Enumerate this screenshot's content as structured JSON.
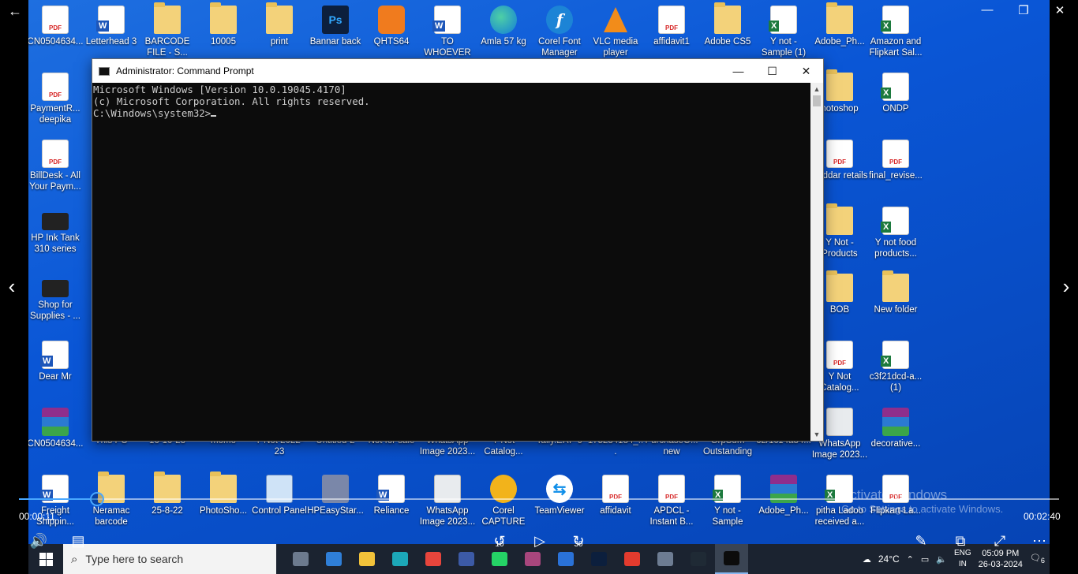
{
  "desktop": {
    "icons": [
      {
        "label": "CN0504634...",
        "kind": "pdf",
        "glyph": ""
      },
      {
        "label": "Letterhead 3",
        "kind": "word",
        "glyph": ""
      },
      {
        "label": "BARCODE FILE - S...",
        "kind": "folder",
        "glyph": ""
      },
      {
        "label": "10005",
        "kind": "folder",
        "glyph": ""
      },
      {
        "label": "print",
        "kind": "folder",
        "glyph": ""
      },
      {
        "label": "Bannar back",
        "kind": "ps",
        "glyph": "Ps"
      },
      {
        "label": "QHTS64",
        "kind": "orange",
        "glyph": ""
      },
      {
        "label": "TO WHOEVER ...",
        "kind": "word",
        "glyph": ""
      },
      {
        "label": "Amla 57 kg",
        "kind": "edge",
        "glyph": ""
      },
      {
        "label": "Corel Font Manager",
        "kind": "corel",
        "glyph": "f"
      },
      {
        "label": "VLC media player",
        "kind": "vlc",
        "glyph": ""
      },
      {
        "label": "affidavit1",
        "kind": "pdf",
        "glyph": ""
      },
      {
        "label": "Adobe CS5",
        "kind": "folder",
        "glyph": ""
      },
      {
        "label": "Y not - Sample (1)",
        "kind": "excel",
        "glyph": ""
      },
      {
        "label": "Adobe_Ph...",
        "kind": "folder",
        "glyph": ""
      },
      {
        "label": "Amazon and Flipkart Sal...",
        "kind": "excel",
        "glyph": ""
      },
      {
        "label": "PaymentR... deepika",
        "kind": "pdf",
        "glyph": ""
      },
      {
        "label": "hotoshop",
        "kind": "folder",
        "glyph": ""
      },
      {
        "label": "ONDP",
        "kind": "excel",
        "glyph": ""
      },
      {
        "label": "BillDesk - All Your Paym...",
        "kind": "pdf",
        "glyph": ""
      },
      {
        "label": "Poddar retails",
        "kind": "pdf",
        "glyph": ""
      },
      {
        "label": "final_revise...",
        "kind": "pdf",
        "glyph": ""
      },
      {
        "label": "HP Ink Tank 310 series",
        "kind": "printer",
        "glyph": ""
      },
      {
        "label": "Y Not - Products",
        "kind": "folder",
        "glyph": ""
      },
      {
        "label": "Y not food products...",
        "kind": "excel",
        "glyph": ""
      },
      {
        "label": "Shop for Supplies - ...",
        "kind": "printer",
        "glyph": ""
      },
      {
        "label": "BOB",
        "kind": "folder",
        "glyph": ""
      },
      {
        "label": "New folder",
        "kind": "folder",
        "glyph": ""
      },
      {
        "label": "Dear Mr",
        "kind": "word",
        "glyph": ""
      },
      {
        "label": "Y Not Catalog...",
        "kind": "pdf",
        "glyph": ""
      },
      {
        "label": "c3f21dcd-a... (1)",
        "kind": "excel",
        "glyph": ""
      },
      {
        "label": "CN0504634...",
        "kind": "rar",
        "glyph": ""
      },
      {
        "label": "WhatsApp Image 2023...",
        "kind": "img",
        "glyph": ""
      },
      {
        "label": "decorative...",
        "kind": "rar",
        "glyph": ""
      },
      {
        "label": "Freight Shippin...",
        "kind": "word",
        "glyph": ""
      },
      {
        "label": "Neramac barcode",
        "kind": "folder",
        "glyph": ""
      },
      {
        "label": "25-8-22",
        "kind": "folder",
        "glyph": ""
      },
      {
        "label": "PhotoSho...",
        "kind": "folder",
        "glyph": ""
      },
      {
        "label": "Control Panel",
        "kind": "cp",
        "glyph": ""
      },
      {
        "label": "HPEasyStar...",
        "kind": "app",
        "glyph": ""
      },
      {
        "label": "Reliance",
        "kind": "word",
        "glyph": ""
      },
      {
        "label": "WhatsApp Image 2023...",
        "kind": "img",
        "glyph": ""
      },
      {
        "label": "Corel CAPTURE",
        "kind": "yellowc",
        "glyph": ""
      },
      {
        "label": "TeamViewer",
        "kind": "tv",
        "glyph": ""
      },
      {
        "label": "affidavit",
        "kind": "pdf",
        "glyph": ""
      },
      {
        "label": "APDCL - Instant B...",
        "kind": "pdf",
        "glyph": ""
      },
      {
        "label": "Y not - Sample",
        "kind": "excel",
        "glyph": ""
      },
      {
        "label": "Adobe_Ph...",
        "kind": "rar",
        "glyph": ""
      },
      {
        "label": "pitha Ladoo received a...",
        "kind": "excel",
        "glyph": ""
      },
      {
        "label": "Flipkart-La...",
        "kind": "pdf",
        "glyph": ""
      }
    ],
    "partial_labels": [
      {
        "label": "This PC"
      },
      {
        "label": "16-10-23"
      },
      {
        "label": "momo"
      },
      {
        "label": "Y Not 2022-23"
      },
      {
        "label": "Untitled-2"
      },
      {
        "label": "Not for sale"
      },
      {
        "label": "WhatsApp Image 2023..."
      },
      {
        "label": "Y Not Catalog..."
      },
      {
        "label": "Tally.ERP 9"
      },
      {
        "label": "175234184_..."
      },
      {
        "label": "PurchaseO... new"
      },
      {
        "label": "GrpSum Outstanding"
      },
      {
        "label": "62/1c14a84..."
      }
    ]
  },
  "cmd": {
    "title": "Administrator: Command Prompt",
    "lines": [
      "Microsoft Windows [Version 10.0.19045.4170]",
      "(c) Microsoft Corporation. All rights reserved.",
      "",
      "C:\\Windows\\system32>"
    ],
    "minimize": "—",
    "maximize": "☐",
    "close": "✕"
  },
  "taskbar": {
    "search_placeholder": "Type here to search",
    "temperature": "24°C",
    "lang_line1": "ENG",
    "lang_line2": "IN",
    "time": "05:09 PM",
    "date": "26-03-2024",
    "notif_count": "6",
    "apps": [
      {
        "name": "task-view",
        "color": "#6c7a8e"
      },
      {
        "name": "mail",
        "color": "#2f7fd8"
      },
      {
        "name": "file-explorer",
        "color": "#f2c23a"
      },
      {
        "name": "edge",
        "color": "#1ca7b8"
      },
      {
        "name": "chrome",
        "color": "#e8453c"
      },
      {
        "name": "outlook",
        "color": "#3c5aa6"
      },
      {
        "name": "whatsapp",
        "color": "#25d366"
      },
      {
        "name": "winrar",
        "color": "#a8467d"
      },
      {
        "name": "store",
        "color": "#2a72d8"
      },
      {
        "name": "photoshop",
        "color": "#0c1f3d"
      },
      {
        "name": "anydesk",
        "color": "#e33b2e"
      },
      {
        "name": "app-bag",
        "color": "#6d7c92"
      },
      {
        "name": "terminal",
        "color": "#1f2a35"
      },
      {
        "name": "cmd",
        "color": "#0c0c0c"
      }
    ]
  },
  "player": {
    "elapsed": "00:00:11",
    "total": "00:02:40",
    "progress": 0.075,
    "skip_back": "10",
    "skip_forward": "30"
  },
  "watermark": {
    "line1": "Activate Windows",
    "line2": "Go to Settings to activate Windows."
  }
}
